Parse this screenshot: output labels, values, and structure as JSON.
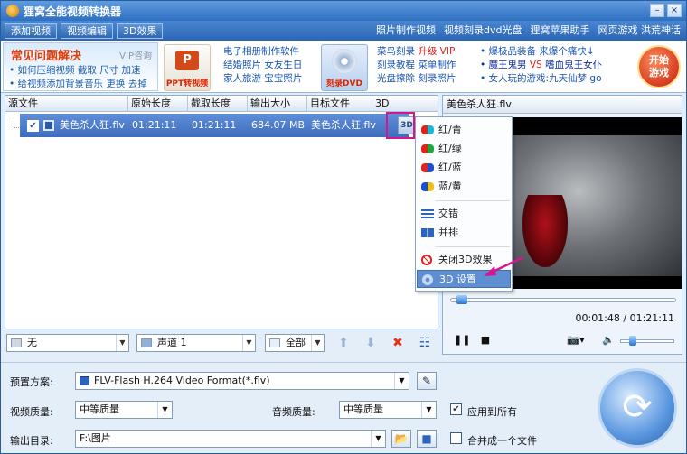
{
  "window": {
    "title": "狸窝全能视频转换器"
  },
  "menubar": {
    "tabs": [
      "添加视频",
      "视频编辑",
      "3D效果"
    ],
    "links": [
      "照片制作视频",
      "视频刻录dvd光盘",
      "狸窝苹果助手",
      "网页游戏 洪荒神话"
    ]
  },
  "adbar": {
    "faq_title": "常见问题解决",
    "vip": "VIP咨询",
    "faq_row1": "• 如何压缩视频  截取  尺寸  加速",
    "faq_row2": "• 给视频添加背景音乐  更换  去掉",
    "ppt_caption": "PPT转视频",
    "photo_col": [
      "电子相册制作软件",
      "结婚照片  女友生日",
      "家人旅游  宝宝照片"
    ],
    "dvd_caption": "刻录DVD",
    "dvd_col1": "菜鸟刻录",
    "dvd_col1_red": "升级 VIP",
    "dvd_col2": "刻录教程  菜单制作",
    "dvd_col3": "光盘擦除  刻录照片",
    "game_row1": "• 爆极品装备  来爆个痛快↓",
    "game_row2_a": "• 魔王鬼男",
    "game_row2_b": "VS",
    "game_row2_c": "嗜血鬼王女仆",
    "game_row3": "• 女人玩的游戏:九天仙梦  go",
    "game_button": "开始\n游戏"
  },
  "filelist": {
    "columns": [
      "源文件",
      "原始长度",
      "截取长度",
      "输出大小",
      "目标文件",
      "3D"
    ],
    "rows": [
      {
        "name": "美色杀人狂.flv",
        "orig": "01:21:11",
        "cut": "01:21:11",
        "size": "684.07 MB",
        "target": "美色杀人狂.flv",
        "threed": "3D"
      }
    ]
  },
  "listbar": {
    "subtitle": "无",
    "audio": "声道 1",
    "range": "全部"
  },
  "preview": {
    "filename": "美色杀人狂.flv",
    "time": "00:01:48 / 01:21:11",
    "seek_fraction": 0.03,
    "volume_fraction": 0.2
  },
  "context_menu": {
    "items": [
      "红/青",
      "红/绿",
      "红/蓝",
      "蓝/黄",
      "交错",
      "并排",
      "关闭3D效果",
      "3D 设置"
    ],
    "selected": "3D 设置"
  },
  "bottom": {
    "preset_label": "预置方案:",
    "preset_value": "FLV-Flash H.264 Video Format(*.flv)",
    "video_quality_label": "视频质量:",
    "video_quality_value": "中等质量",
    "audio_quality_label": "音频质量:",
    "audio_quality_value": "中等质量",
    "apply_all": "应用到所有",
    "apply_all_checked": true,
    "output_label": "输出目录:",
    "output_value": "F:\\图片",
    "merge": "合并成一个文件",
    "merge_checked": false
  }
}
